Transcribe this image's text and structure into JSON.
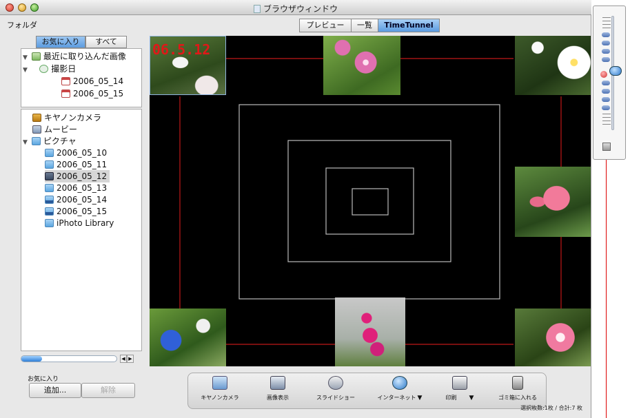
{
  "window": {
    "title": "ブラウザウィンドウ"
  },
  "sidebar": {
    "folder_label": "フォルダ",
    "seg_favorites": "お気に入り",
    "seg_all": "すべて",
    "recent": {
      "root": "最近に取り込んだ画像",
      "group": "撮影日",
      "items": [
        "2006_05_14",
        "2006_05_15"
      ]
    },
    "tree": {
      "canon": "キヤノンカメラ",
      "movies": "ムービー",
      "pictures": "ピクチャ",
      "folders": [
        "2006_05_10",
        "2006_05_11",
        "2006_05_12",
        "2006_05_13",
        "2006_05_14",
        "2006_05_15",
        "iPhoto Library"
      ],
      "selected": "2006_05_12"
    },
    "favorites_label": "お気に入り",
    "add_button": "追加...",
    "remove_button": "解除"
  },
  "view_tabs": [
    "プレビュー",
    "一覧",
    "TimeTunnel"
  ],
  "active_tab": "TimeTunnel",
  "timetunnel": {
    "date_label": "06.5.12"
  },
  "toolbar": {
    "canon_camera": "キヤノンカメラ",
    "image_view": "画像表示",
    "slideshow": "スライドショー",
    "internet": "インターネット",
    "print": "印刷",
    "trash": "ゴミ箱に入れる"
  },
  "status_bar": "選択枚数:1枚 / 合計:7 枚",
  "colors": {
    "accent": "#5b9be0",
    "tunnel_red": "#cc1a1a"
  }
}
